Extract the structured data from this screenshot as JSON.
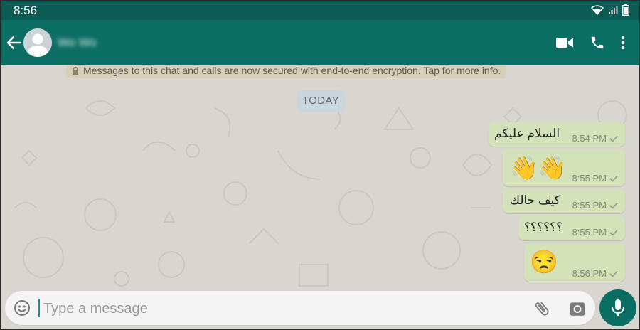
{
  "status_bar": {
    "time": "8:56",
    "icons": [
      "wifi-icon",
      "signal-icon",
      "battery-icon"
    ]
  },
  "header": {
    "contact_name": "Wo Wo",
    "actions": [
      "video-call-icon",
      "voice-call-icon",
      "more-options-icon"
    ]
  },
  "chat": {
    "encryption_notice": "Messages to this chat and calls are now secured with end-to-end encryption. Tap for more info.",
    "date_divider": "TODAY",
    "messages": [
      {
        "text": "السلام عليكم",
        "time": "8:54 PM",
        "status": "sent"
      },
      {
        "text": "👋👋",
        "time": "8:55 PM",
        "status": "sent"
      },
      {
        "text": "كيف حالك",
        "time": "8:55 PM",
        "status": "sent"
      },
      {
        "text": "؟؟؟؟؟؟",
        "time": "8:55 PM",
        "status": "sent"
      },
      {
        "text": "😒",
        "time": "8:56 PM",
        "status": "sent"
      }
    ]
  },
  "composer": {
    "placeholder": "Type a message",
    "value": ""
  },
  "colors": {
    "header": "#0b6e64",
    "status_bar": "#0a5c54",
    "outgoing_bubble": "#d3e2b8",
    "chat_background": "#d9d5cf",
    "accent": "#1f8f7e"
  }
}
